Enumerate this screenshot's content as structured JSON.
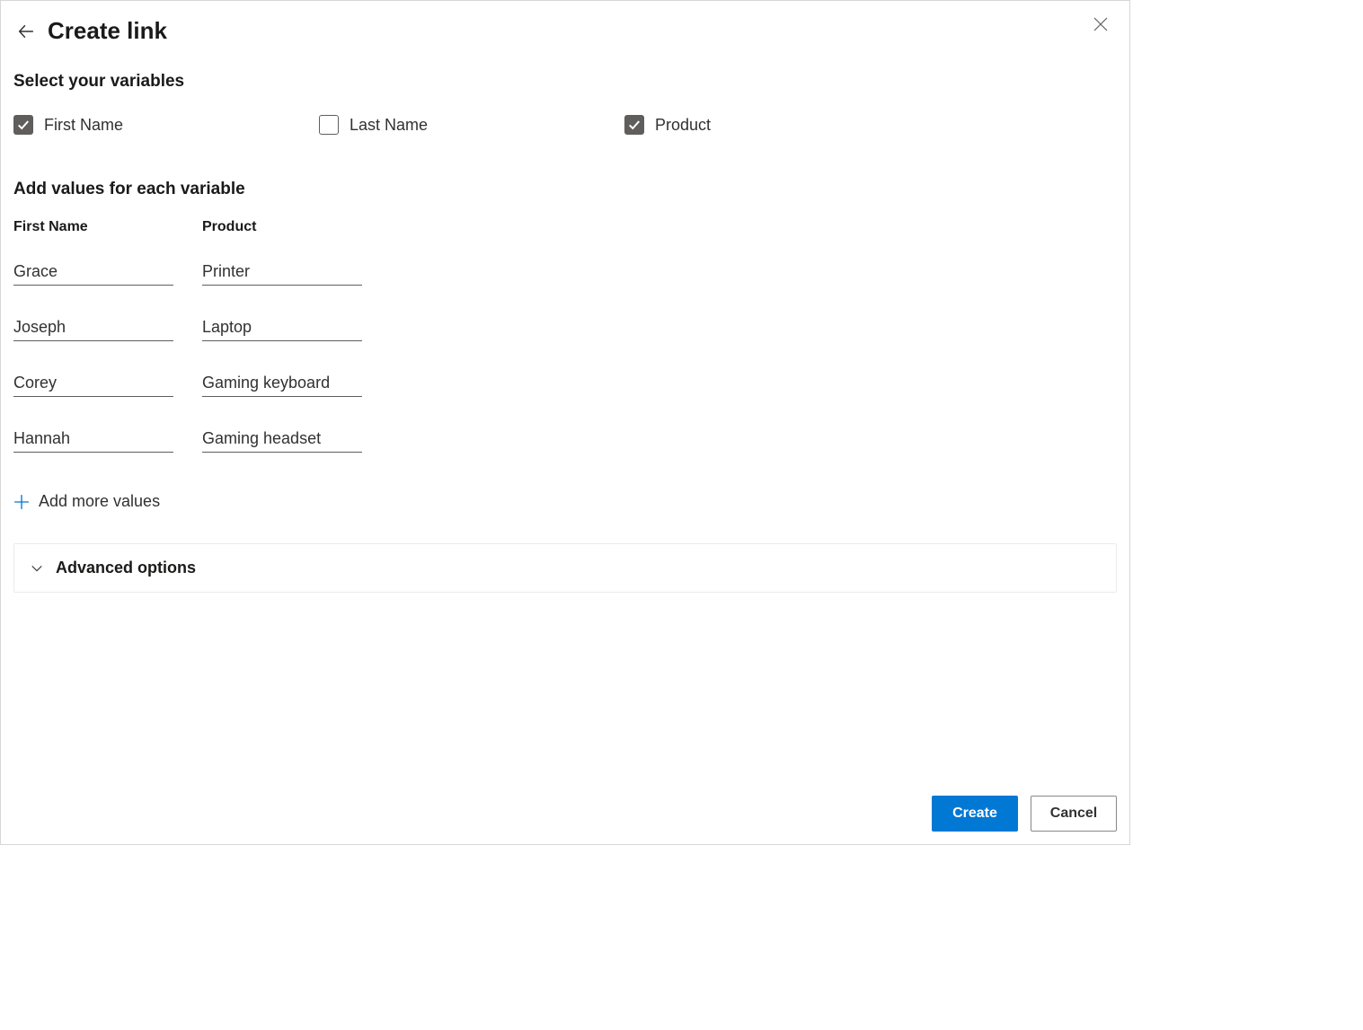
{
  "header": {
    "title": "Create link"
  },
  "sections": {
    "selectVariablesHeading": "Select your variables",
    "addValuesHeading": "Add values for each variable"
  },
  "variables": [
    {
      "label": "First Name",
      "checked": true
    },
    {
      "label": "Last Name",
      "checked": false
    },
    {
      "label": "Product",
      "checked": true
    }
  ],
  "columns": [
    {
      "header": "First Name",
      "values": [
        "Grace",
        "Joseph",
        "Corey",
        "Hannah"
      ]
    },
    {
      "header": "Product",
      "values": [
        "Printer",
        "Laptop",
        "Gaming keyboard",
        "Gaming headset"
      ]
    }
  ],
  "actions": {
    "addMoreLabel": "Add more values",
    "advancedLabel": "Advanced options",
    "createLabel": "Create",
    "cancelLabel": "Cancel"
  }
}
